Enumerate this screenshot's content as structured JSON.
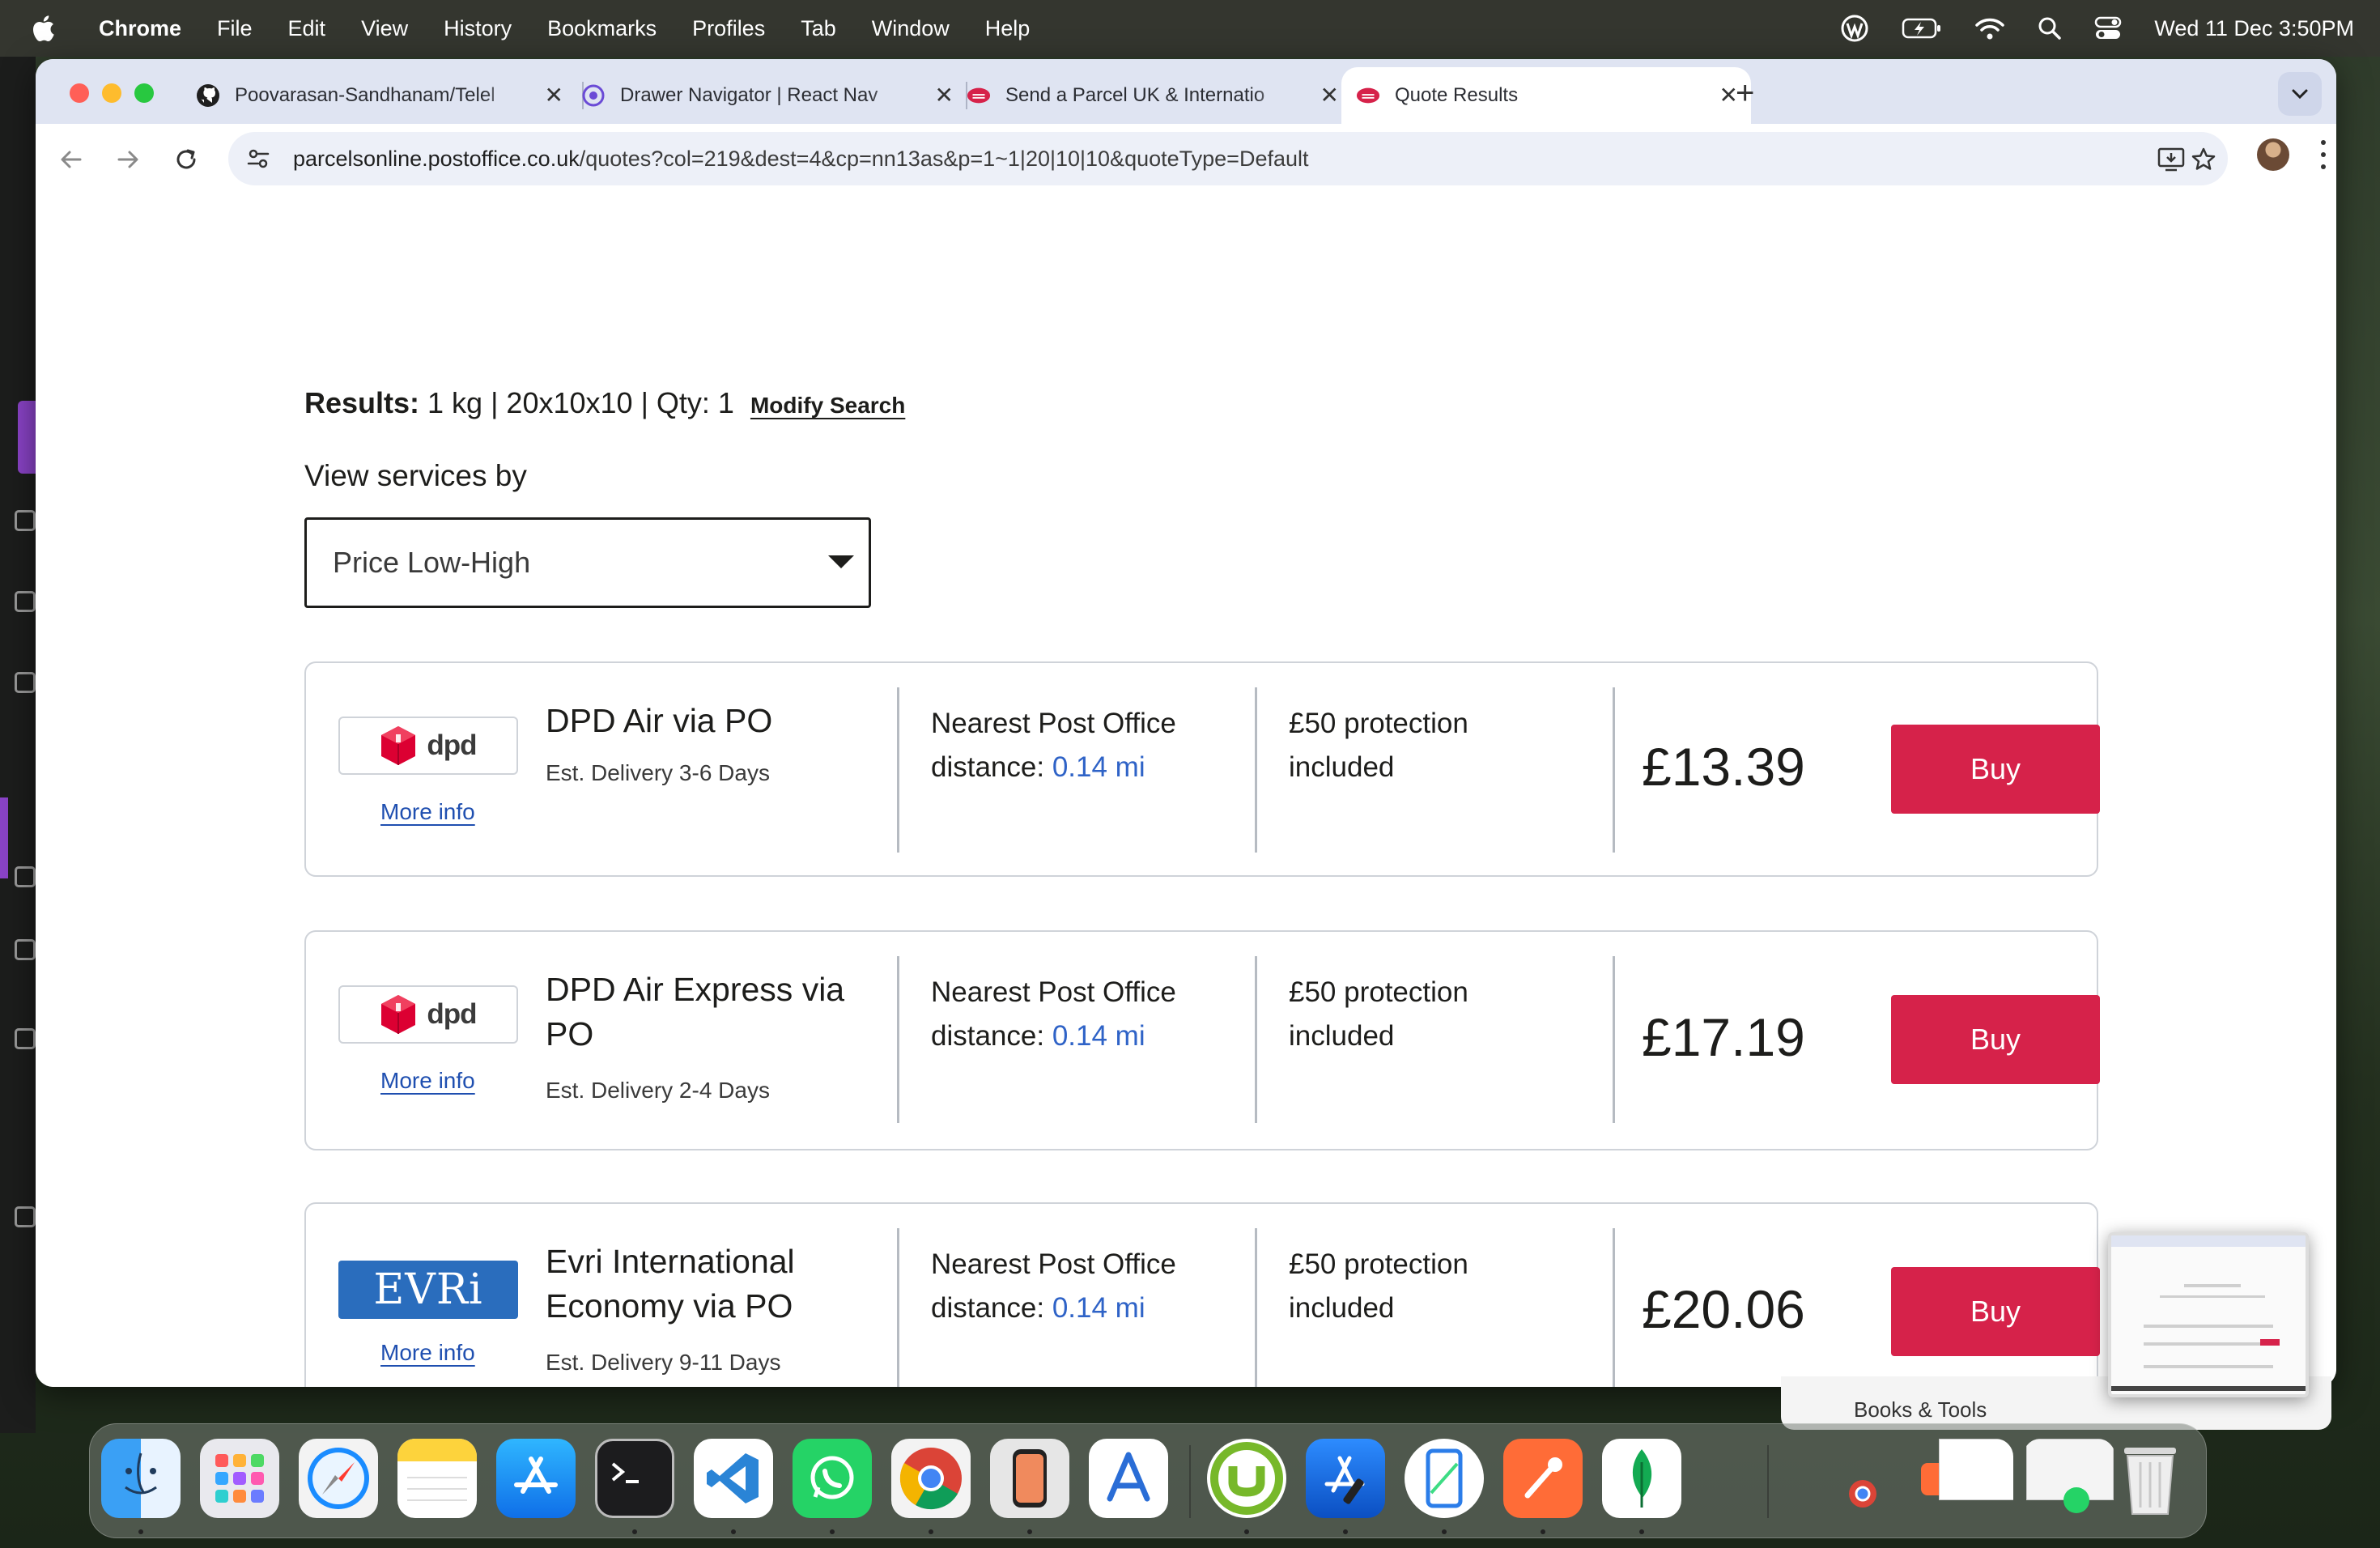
{
  "menubar": {
    "app": "Chrome",
    "items": [
      "File",
      "Edit",
      "View",
      "History",
      "Bookmarks",
      "Profiles",
      "Tab",
      "Window",
      "Help"
    ],
    "clock": "Wed 11 Dec  3:50PM"
  },
  "browser": {
    "tabs": [
      {
        "title": "Poovarasan-Sandhanam/Telel",
        "icon": "github-icon"
      },
      {
        "title": "Drawer Navigator | React Nav",
        "icon": "react-navigation-icon"
      },
      {
        "title": "Send a Parcel UK & Internatio",
        "icon": "post-office-icon"
      },
      {
        "title": "Quote Results",
        "icon": "post-office-icon",
        "active": true
      }
    ],
    "url_host": "parcelsonline.postoffice.co.uk",
    "url_path": "/quotes?col=219&dest=4&cp=nn13as&p=1~1|20|10|10&quoteType=Default"
  },
  "results": {
    "label": "Results:",
    "summary": "1 kg | 20x10x10 | Qty: 1",
    "modify": "Modify Search"
  },
  "view_by": {
    "label": "View services by",
    "selected": "Price Low-High"
  },
  "services": [
    {
      "carrier": "dpd",
      "name": "DPD Air via PO",
      "est": "Est. Delivery 3-6 Days",
      "more_info": "More info",
      "nearest_prefix": "Nearest Post Office distance:",
      "distance": "0.14 mi",
      "protection": "£50 protection included",
      "price": "£13.39",
      "buy": "Buy"
    },
    {
      "carrier": "dpd",
      "name": "DPD Air Express via PO",
      "est": "Est. Delivery 2-4 Days",
      "more_info": "More info",
      "nearest_prefix": "Nearest Post Office distance:",
      "distance": "0.14 mi",
      "protection": "£50 protection included",
      "price": "£17.19",
      "buy": "Buy"
    },
    {
      "carrier": "EVRi",
      "name": "Evri International Economy via PO",
      "est": "Est. Delivery 9-11 Days",
      "more_info": "More info",
      "nearest_prefix": "Nearest Post Office distance:",
      "distance": "0.14 mi",
      "protection": "£50 protection included",
      "price": "£20.06",
      "buy": "Buy"
    }
  ],
  "behind_window": {
    "text": "Books & Tools"
  },
  "dock": {
    "apps": [
      "Finder",
      "Launchpad",
      "Safari",
      "Notes",
      "App Store",
      "Terminal",
      "Visual Studio Code",
      "WhatsApp",
      "Chrome",
      "Simulator",
      "Instruments",
      "uTorrent",
      "Xcode",
      "Android Emulator",
      "Postman",
      "MongoDB Compass"
    ]
  },
  "colors": {
    "buy_button": "#d6224a",
    "distance_link": "#2f63c7",
    "more_info_link": "#1f4fb0",
    "evri_blue": "#2a6dbd",
    "dpd_red": "#dc0032"
  }
}
